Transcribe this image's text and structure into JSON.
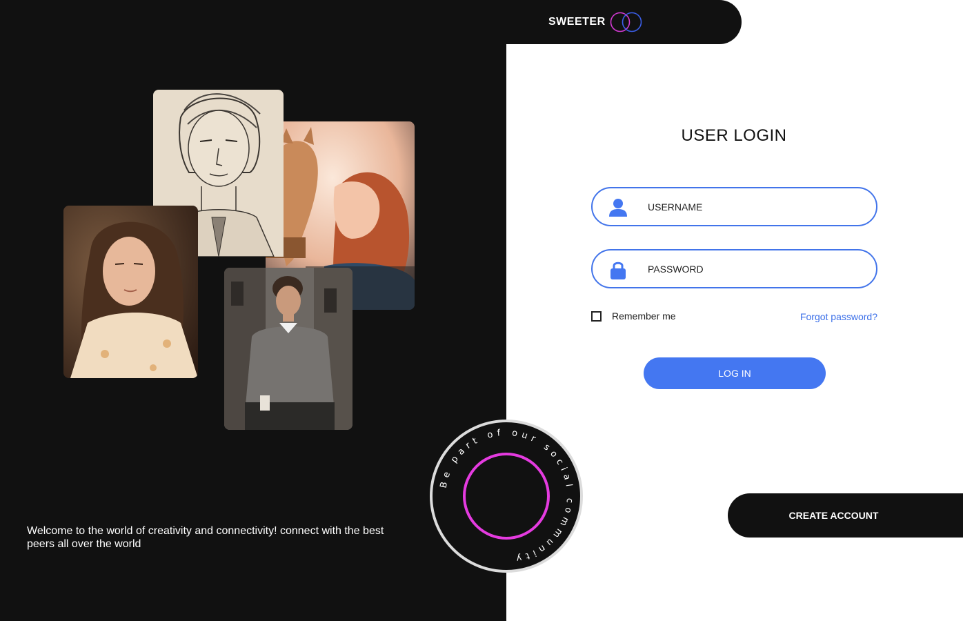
{
  "brand": {
    "name": "SWEETER",
    "logo_icon": "interlocking-rings-logo",
    "logo_colors": [
      "#d43ad4",
      "#3b5ee8"
    ]
  },
  "gallery": {
    "images": [
      {
        "name": "sketch-portrait"
      },
      {
        "name": "girl-with-cat"
      },
      {
        "name": "girl-portrait"
      },
      {
        "name": "man-with-coffee"
      }
    ]
  },
  "welcome_text": "Welcome to the world of creativity and connectivity! connect with the best peers all over the world",
  "badge": {
    "text": "Be part of our social community",
    "ring_color": "#e53be0"
  },
  "login": {
    "title": "USER LOGIN",
    "username": {
      "placeholder": "USERNAME",
      "value": "",
      "icon": "user-icon"
    },
    "password": {
      "placeholder": "PASSWORD",
      "value": "",
      "icon": "lock-icon"
    },
    "remember_label": "Remember me",
    "remember_checked": false,
    "forgot_label": "Forgot password?",
    "login_button": "LOG IN",
    "create_account_button": "CREATE ACCOUNT"
  },
  "colors": {
    "dark": "#111111",
    "accent_blue": "#4477f1",
    "link_blue": "#3b6fe8",
    "ring_pink": "#e53be0"
  }
}
